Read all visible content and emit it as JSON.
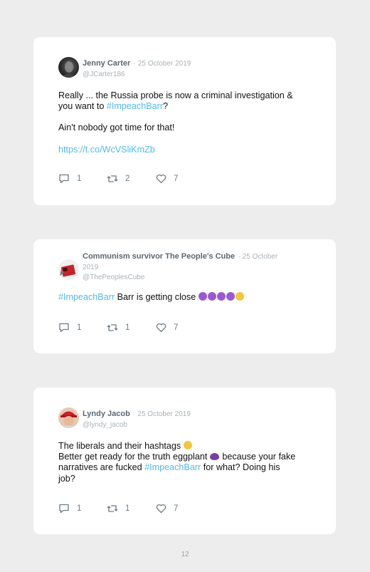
{
  "tweets": [
    {
      "name": "Jenny Carter",
      "date": "· 25 October 2019",
      "handle": "@JCarter186",
      "line1": "Really ... the Russia probe is now a criminal investigation &",
      "line2_prefix": "you want to ",
      "line2_tag": "#ImpeachBarr",
      "line2_suffix": "?",
      "para2": "Ain't nobody got time for that!",
      "link": "https://t.co/WcVSliKmZb",
      "replies": "1",
      "retweets": "2",
      "likes": "7"
    },
    {
      "name": "Communism survivor The People's Cube",
      "date": "· 25 October",
      "date2": "2019",
      "handle": "@ThePeoplesCube",
      "tag": "#ImpeachBarr",
      "text": " Barr is getting close ",
      "emojis": [
        "devil",
        "devil",
        "devil",
        "devil",
        "grin"
      ],
      "replies": "1",
      "retweets": "1",
      "likes": "7"
    },
    {
      "name": "Lyndy Jacob",
      "date": "· 25 October 2019",
      "handle": "@lyndy_jacob",
      "line1": "The liberals and their hashtags ",
      "line1_emoji": "laughing",
      "line2": "Better get ready for the truth eggplant ",
      "line2_emoji": "eggplant",
      "line2_suffix": " because your fake",
      "line3_prefix": "narratives are fucked ",
      "line3_tag": "#ImpeachBarr",
      "line3_suffix": " for what? Doing his",
      "line4": "job?",
      "replies": "1",
      "retweets": "1",
      "likes": "7"
    }
  ],
  "page_number": "12",
  "colors": {
    "hashtag": "#55b8e8",
    "name": "#5b6770",
    "muted": "#a9b2b9",
    "card": "#ffffff",
    "background": "#ededed"
  }
}
